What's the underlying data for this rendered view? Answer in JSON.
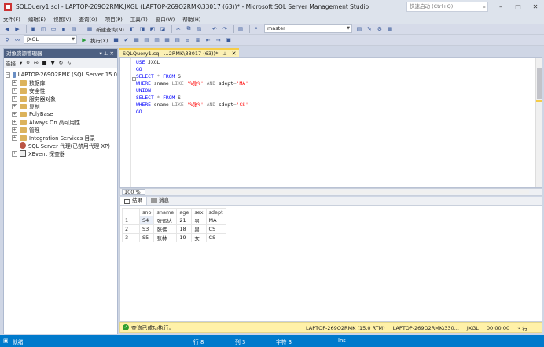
{
  "window": {
    "title": "SQLQuery1.sql - LAPTOP-269O2RMK.JXGL (LAPTOP-269O2RMK\\33017 (63))* - Microsoft SQL Server Management Studio",
    "quick_launch": "快速启动 (Ctrl+Q)"
  },
  "menu": [
    "文件(F)",
    "编辑(E)",
    "视图(V)",
    "查询(Q)",
    "项目(P)",
    "工具(T)",
    "窗口(W)",
    "帮助(H)"
  ],
  "toolbar": {
    "new_query": "新建查询(N)",
    "database": "JXGL",
    "execute": "执行(X)",
    "master": "master"
  },
  "object_explorer": {
    "title": "对象资源管理器",
    "connect": "连接",
    "server": "LAPTOP-269O2RMK (SQL Server 15.0",
    "nodes": [
      "数据库",
      "安全性",
      "服务器对象",
      "复制",
      "PolyBase",
      "Always On 高可用性",
      "管理",
      "Integration Services 目录",
      "SQL Server 代理(已禁用代理 XP)",
      "XEvent 探查器"
    ]
  },
  "editor": {
    "tab_title": "SQLQuery1.sql -...2RMK\\33017 (63))*",
    "zoom": "100 %"
  },
  "results": {
    "tabs": [
      "结果",
      "消息"
    ],
    "columns": [
      "sno",
      "sname",
      "age",
      "sex",
      "sdept"
    ],
    "rows": [
      {
        "num": "1",
        "sno": "S4",
        "sname": "张运达",
        "age": "21",
        "sex": "男",
        "sdept": "MA"
      },
      {
        "num": "2",
        "sno": "S3",
        "sname": "张伟",
        "age": "18",
        "sex": "男",
        "sdept": "CS"
      },
      {
        "num": "3",
        "sno": "S5",
        "sname": "张林",
        "age": "19",
        "sex": "女",
        "sdept": "CS"
      }
    ]
  },
  "query_status": {
    "message": "查询已成功执行。",
    "server": "LAPTOP-269O2RMK (15.0 RTM)",
    "user": "LAPTOP-269O2RMK\\330...",
    "db": "JXGL",
    "time": "00:00:00",
    "rows": "3 行"
  },
  "statusbar": {
    "ready": "就绪",
    "line": "行 8",
    "col": "列 3",
    "char": "字符 3",
    "mode": "Ins"
  }
}
